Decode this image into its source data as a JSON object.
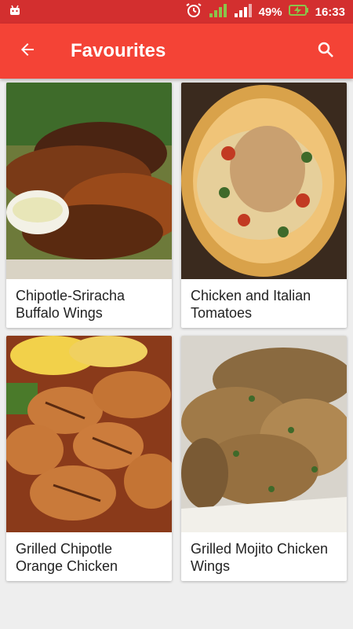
{
  "status_bar": {
    "battery": "49%",
    "time": "16:33",
    "icons": [
      "android-icon",
      "alarm-icon",
      "signal-icon",
      "signal-2-icon",
      "battery-charging-icon"
    ]
  },
  "app_bar": {
    "title": "Favourites",
    "back_icon": "arrow-back-icon",
    "search_icon": "search-icon"
  },
  "recipes": [
    {
      "title": "Chipotle-Sriracha Buffalo Wings",
      "image": "buffalo-wings-photo"
    },
    {
      "title": "Chicken and Italian Tomatoes",
      "image": "chicken-tomatoes-photo"
    },
    {
      "title": "Grilled Chipotle Orange Chicken",
      "image": "grilled-chicken-photo"
    },
    {
      "title": "Grilled Mojito Chicken Wings",
      "image": "mojito-wings-photo"
    }
  ],
  "colors": {
    "app_bar": "#f44336",
    "status_bar": "#d32f2f",
    "background": "#eeeeee"
  }
}
